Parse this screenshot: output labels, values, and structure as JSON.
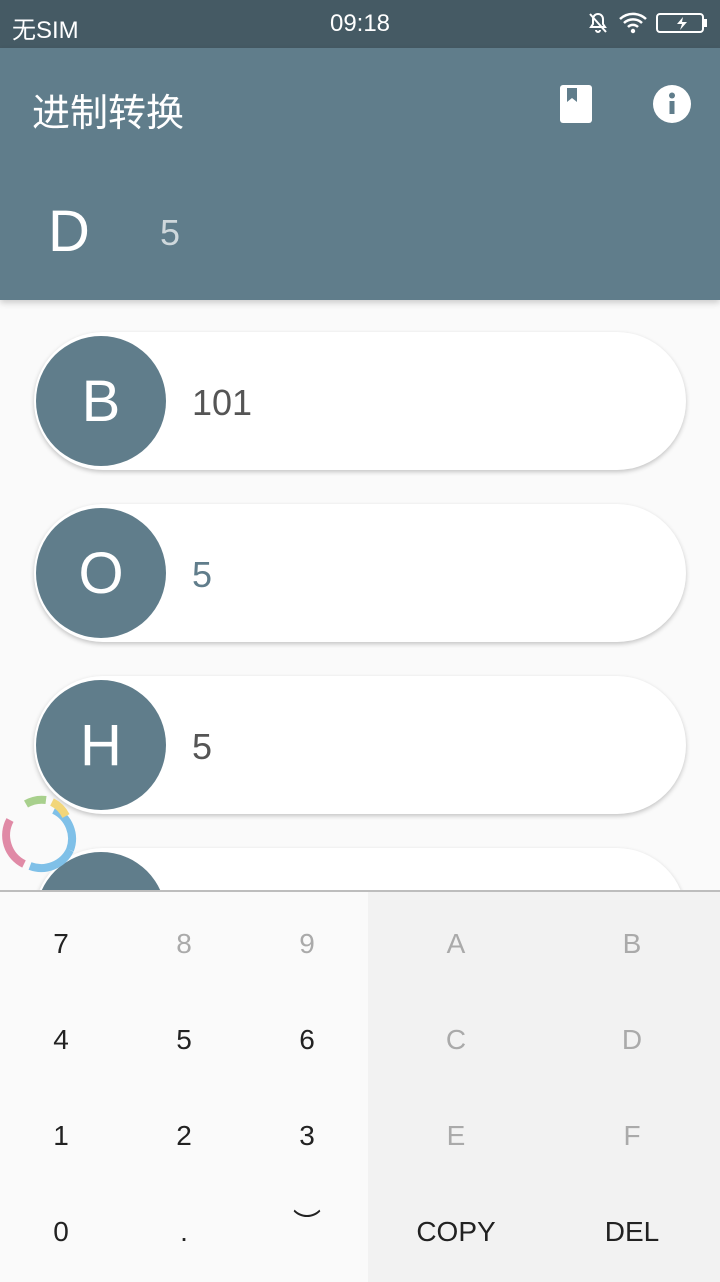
{
  "status_bar": {
    "carrier": "无SIM",
    "time": "09:18"
  },
  "app_bar": {
    "title": "进制转换",
    "icons": [
      "book-icon",
      "info-icon"
    ]
  },
  "input": {
    "label": "D",
    "value": "5"
  },
  "results": [
    {
      "label": "B",
      "value": "101",
      "active": false
    },
    {
      "label": "O",
      "value": "5",
      "active": true
    },
    {
      "label": "H",
      "value": "5",
      "active": false
    },
    {
      "label": "",
      "value": "",
      "active": false
    }
  ],
  "keypad": {
    "digits": [
      [
        {
          "label": "7",
          "enabled": true
        },
        {
          "label": "8",
          "enabled": false
        },
        {
          "label": "9",
          "enabled": false
        }
      ],
      [
        {
          "label": "4",
          "enabled": true
        },
        {
          "label": "5",
          "enabled": true
        },
        {
          "label": "6",
          "enabled": true
        }
      ],
      [
        {
          "label": "1",
          "enabled": true
        },
        {
          "label": "2",
          "enabled": true
        },
        {
          "label": "3",
          "enabled": true
        }
      ],
      [
        {
          "label": "0",
          "enabled": true
        },
        {
          "label": ".",
          "enabled": true
        },
        {
          "label": "︶",
          "enabled": true
        }
      ]
    ],
    "hex": [
      [
        {
          "label": "A",
          "enabled": false
        },
        {
          "label": "B",
          "enabled": false
        }
      ],
      [
        {
          "label": "C",
          "enabled": false
        },
        {
          "label": "D",
          "enabled": false
        }
      ],
      [
        {
          "label": "E",
          "enabled": false
        },
        {
          "label": "F",
          "enabled": false
        }
      ],
      [
        {
          "label": "COPY",
          "enabled": true
        },
        {
          "label": "DEL",
          "enabled": true
        }
      ]
    ]
  },
  "colors": {
    "primary": "#607d8b",
    "primary_dark": "#455a64",
    "background": "#fafafa"
  }
}
